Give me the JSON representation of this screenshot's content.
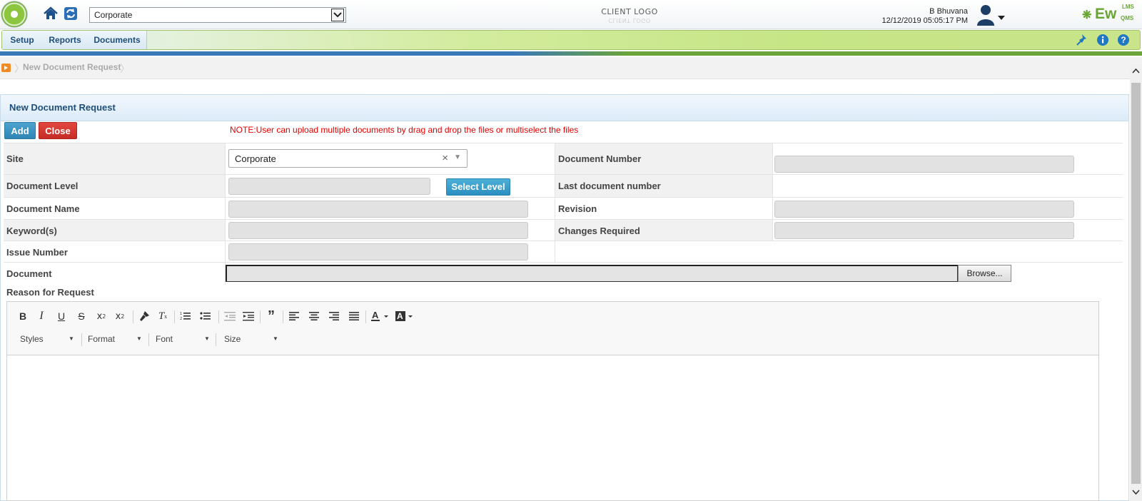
{
  "header": {
    "site_value": "Corporate",
    "client_logo": "CLIENT LOGO",
    "user_name": "B Bhuvana",
    "datetime": "12/12/2019 05:05:17 PM",
    "brand_main": "Ew",
    "brand_top": "LMS",
    "brand_bottom": "QMS"
  },
  "menu": {
    "items": [
      {
        "label": "Setup"
      },
      {
        "label": "Reports"
      },
      {
        "label": "Documents"
      }
    ]
  },
  "breadcrumb": {
    "current": "New Document Request"
  },
  "panel": {
    "title": "New Document Request",
    "add_label": "Add",
    "close_label": "Close",
    "note": "NOTE:User can upload multiple documents by drag and drop the files or multiselect the files"
  },
  "form": {
    "site_label": "Site",
    "site_value": "Corporate",
    "document_number_label": "Document Number",
    "document_level_label": "Document Level",
    "select_level_label": "Select Level",
    "last_document_number_label": "Last document number",
    "document_name_label": "Document Name",
    "revision_label": "Revision",
    "keywords_label": "Keyword(s)",
    "changes_required_label": "Changes Required",
    "issue_number_label": "Issue Number",
    "document_label": "Document",
    "browse_label": "Browse...",
    "reason_label": "Reason for Request"
  },
  "editor": {
    "combos": [
      {
        "label": "Styles"
      },
      {
        "label": "Format"
      },
      {
        "label": "Font"
      },
      {
        "label": "Size"
      }
    ]
  },
  "colors": {
    "accent_blue": "#1f4e79",
    "add_button": "#2f86b4",
    "close_button": "#c62c26",
    "note_red": "#e00000",
    "brand_green": "#6aa534"
  }
}
